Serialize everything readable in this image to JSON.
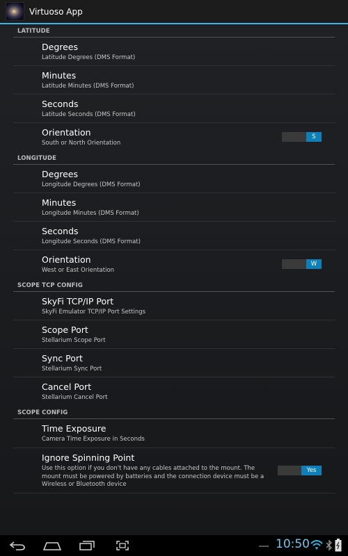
{
  "app": {
    "title": "Virtuoso App"
  },
  "sections": {
    "latitude": {
      "header": "LATITUDE",
      "degrees": {
        "title": "Degrees",
        "summary": "Latitude Degrees (DMS Format)"
      },
      "minutes": {
        "title": "Minutes",
        "summary": "Latitude Minutes (DMS Format)"
      },
      "seconds": {
        "title": "Seconds",
        "summary": "Latitude Seconds (DMS Format)"
      },
      "orientation": {
        "title": "Orientation",
        "summary": "South or North Orientation",
        "toggle": "S"
      }
    },
    "longitude": {
      "header": "LONGITUDE",
      "degrees": {
        "title": "Degrees",
        "summary": "Longitude Degrees (DMS Format)"
      },
      "minutes": {
        "title": "Minutes",
        "summary": "Longitude Minutes (DMS Format)"
      },
      "seconds": {
        "title": "Seconds",
        "summary": "Longitude Seconds (DMS Format)"
      },
      "orientation": {
        "title": "Orientation",
        "summary": "West or East Orientation",
        "toggle": "W"
      }
    },
    "tcp": {
      "header": "SCOPE TCP CONFIG",
      "skyfi": {
        "title": "SkyFi TCP/IP Port",
        "summary": "SkyFi Emulator TCP/IP Port Settings"
      },
      "scope": {
        "title": "Scope Port",
        "summary": "Stellarium Scope Port"
      },
      "sync": {
        "title": "Sync Port",
        "summary": "Stellarium Sync Port"
      },
      "cancel": {
        "title": "Cancel Port",
        "summary": "Stellarium Cancel Port"
      }
    },
    "config": {
      "header": "SCOPE CONFIG",
      "exposure": {
        "title": "Time Exposure",
        "summary": "Camera Time Exposure in Seconds"
      },
      "spinning": {
        "title": "Ignore Spinning Point",
        "summary": "Use this option if you don't have any cables attached to the mount. The mount must be powered by batteries and the connection device must be a Wireless or Bluetooth device",
        "toggle": "Yes"
      }
    }
  },
  "status": {
    "clock": "10:50"
  },
  "colors": {
    "accent": "#33b5e5",
    "toggle_on": "#0f7fb8",
    "clock": "#6fc7ee"
  }
}
